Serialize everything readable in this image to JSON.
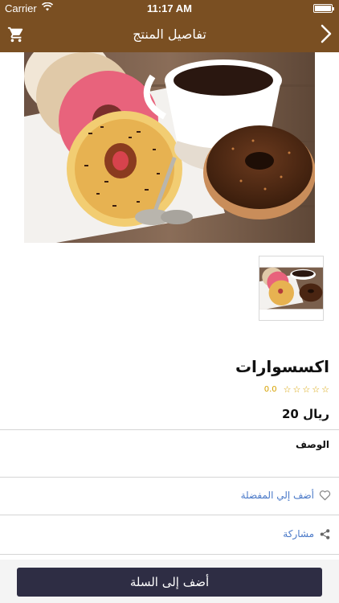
{
  "status_bar": {
    "carrier": "Carrier",
    "time": "11:17 AM"
  },
  "nav": {
    "title": "تفاصيل المنتج",
    "cart_icon": "cart-icon",
    "back_icon": "chevron-right-icon"
  },
  "product": {
    "name": "اكسسوارات",
    "rating_value": "0.0",
    "rating_stars": 5,
    "price": "20 ريال",
    "description_label": "الوصف"
  },
  "actions": {
    "favorite_label": "أضف إلي المفضلة",
    "favorite_icon": "heart-icon",
    "share_label": "مشاركة",
    "share_icon": "share-icon"
  },
  "bottom": {
    "add_to_cart_label": "أضف إلى السلة"
  },
  "colors": {
    "nav_bg": "#7a4f22",
    "button_bg": "#2e2d44",
    "link": "#4a79c8",
    "star": "#d6a100"
  }
}
